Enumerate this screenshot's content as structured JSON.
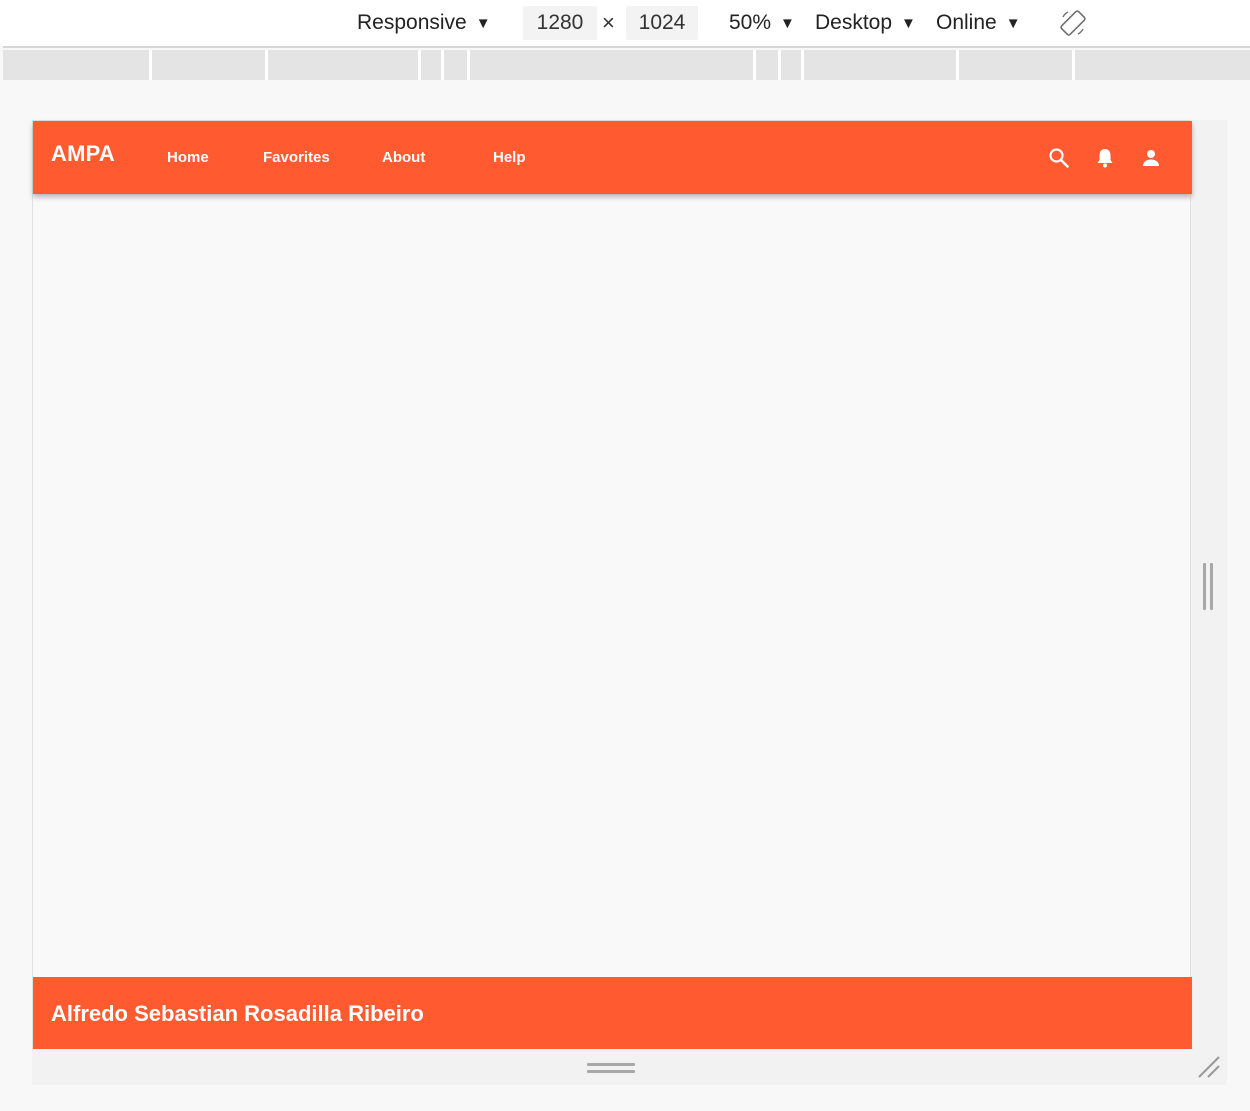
{
  "devtools": {
    "device": "Responsive",
    "width": "1280",
    "times": "×",
    "height": "1024",
    "zoom": "50%",
    "device_type": "Desktop",
    "throttling": "Online",
    "icons": {
      "caret": "caret-down-icon",
      "rotate": "rotate-icon"
    }
  },
  "app": {
    "brand": "AMPA",
    "nav": {
      "home": "Home",
      "favorites": "Favorites",
      "about": "About",
      "help": "Help"
    },
    "header_icons": [
      "search-icon",
      "bell-icon",
      "person-icon"
    ],
    "footer_name": "Alfredo Sebastian Rosadilla Ribeiro"
  },
  "colors": {
    "accent": "#ff5a30",
    "page_background": "#f9f9f9",
    "toolbar_background": "#ffffff",
    "media_query_bar": "#e4e4e4"
  }
}
